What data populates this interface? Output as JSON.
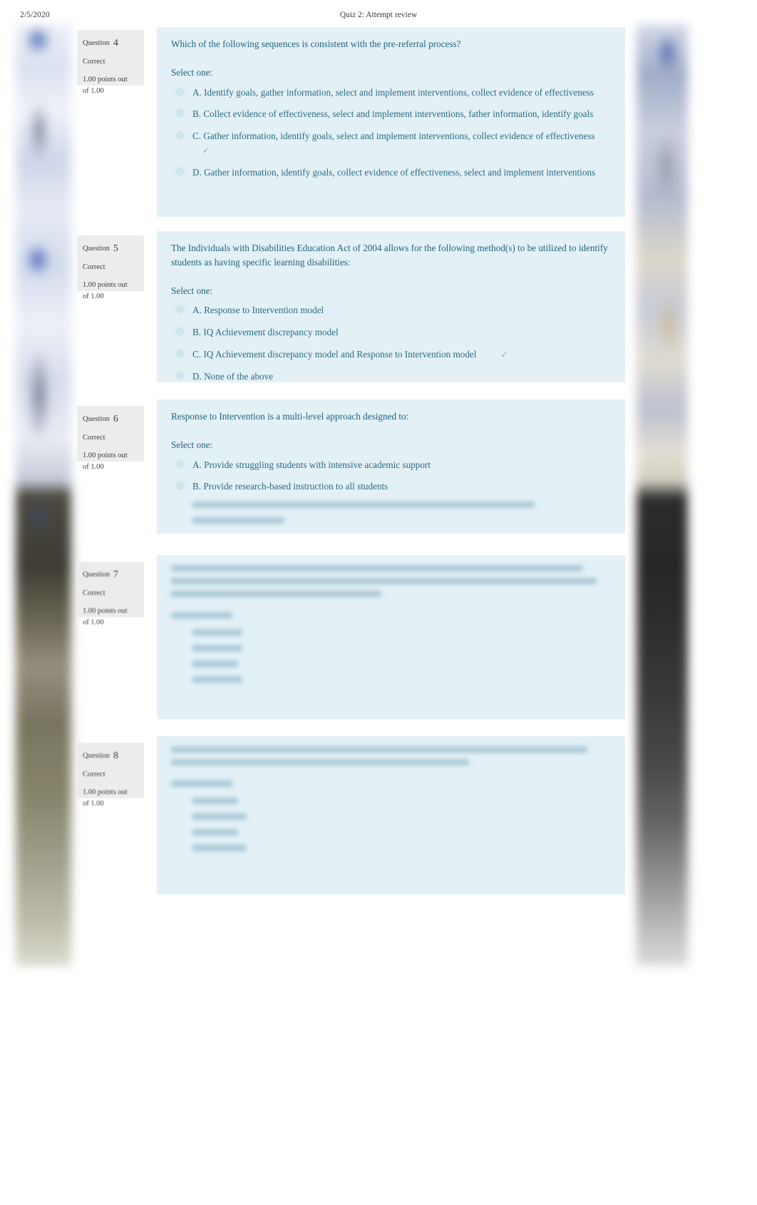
{
  "header": {
    "date": "2/5/2020",
    "title": "Quiz 2: Attempt review"
  },
  "labels": {
    "question_word": "Question",
    "select_one": "Select one:",
    "correct_mark": "✓"
  },
  "questions": [
    {
      "number": "4",
      "state": "Correct",
      "grade_line1": "1.00 points out",
      "grade_line2": "of 1.00",
      "text": "Which of the following sequences is consistent with the pre-referral process?",
      "select_one": "Select one:",
      "options": [
        {
          "label": "A. Identify goals, gather information, select and implement interventions, collect evidence of effectiveness",
          "marked": false
        },
        {
          "label": "B. Collect evidence of effectiveness, select and implement interventions, father information, identify goals",
          "marked": false
        },
        {
          "label": "C. Gather information, identify goals, select and implement interventions, collect evidence of effectiveness",
          "marked": true
        },
        {
          "label": "D. Gather information, identify goals, collect evidence of effectiveness, select and implement interventions",
          "marked": false
        }
      ],
      "legible": true
    },
    {
      "number": "5",
      "state": "Correct",
      "grade_line1": "1.00 points out",
      "grade_line2": "of 1.00",
      "text": "The Individuals with Disabilities Education Act of 2004 allows for the following method(s) to be utilized to identify students as having specific learning disabilities:",
      "select_one": "Select one:",
      "options": [
        {
          "label": "A. Response to Intervention model",
          "marked": false
        },
        {
          "label": "B. IQ Achievement discrepancy model",
          "marked": false
        },
        {
          "label": "C. IQ Achievement discrepancy model and Response to Intervention model",
          "marked": true
        },
        {
          "label": "D. None of the above",
          "marked": false
        }
      ],
      "legible": true
    },
    {
      "number": "6",
      "state": "Correct",
      "grade_line1": "1.00 points out",
      "grade_line2": "of 1.00",
      "text": "Response to Intervention is a multi-level approach designed to:",
      "select_one": "Select one:",
      "options": [
        {
          "label": "A. Provide struggling students with intensive academic support",
          "marked": false
        },
        {
          "label": "B. Provide research-based instruction to all students",
          "marked": false
        }
      ],
      "legible": true,
      "obscured_options": 2
    },
    {
      "number": "7",
      "state": "Correct",
      "grade_line1": "1.00 points out",
      "grade_line2": "of 1.00",
      "legible": false
    },
    {
      "number": "8",
      "state": "Correct",
      "grade_line1": "1.00 points out",
      "grade_line2": "of 1.00",
      "legible": false
    }
  ]
}
